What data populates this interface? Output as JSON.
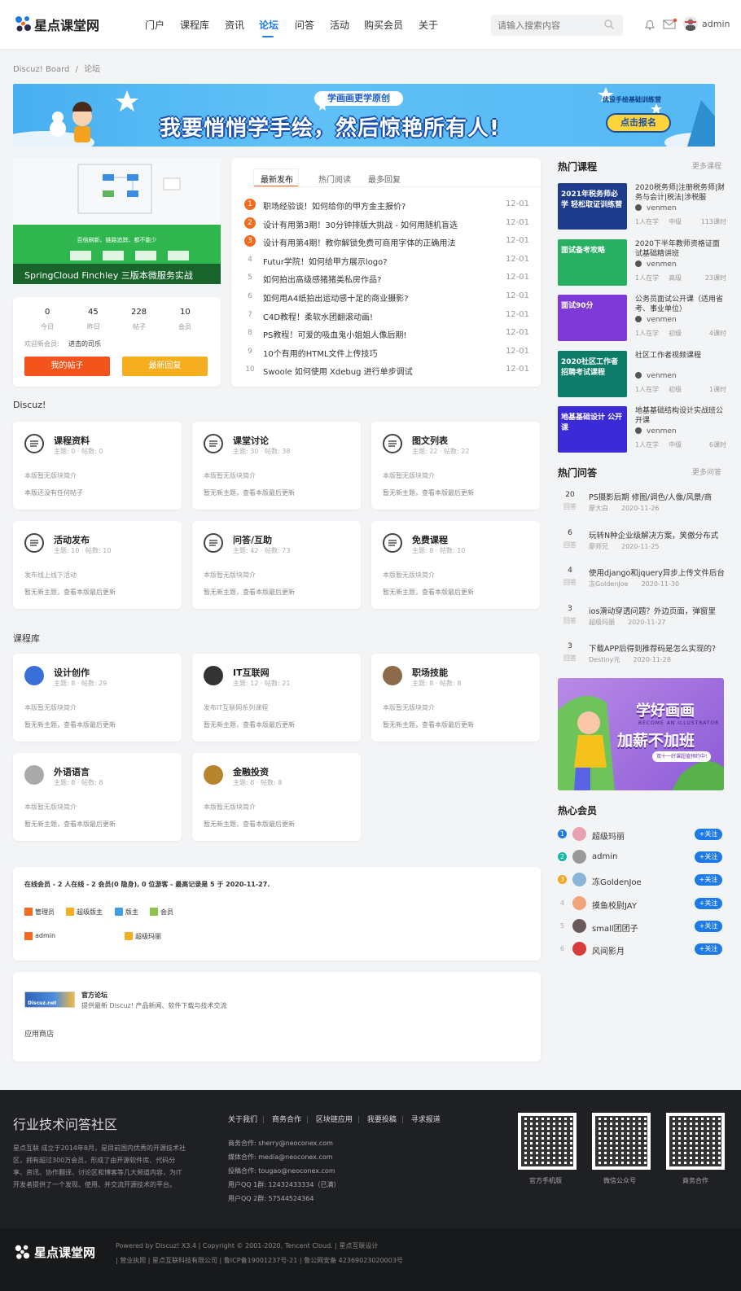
{
  "header": {
    "logo_text": "星点课堂网",
    "nav": [
      "门户",
      "课程库",
      "资讯",
      "论坛",
      "问答",
      "活动",
      "购买会员",
      "关于"
    ],
    "active_nav": "论坛",
    "search_placeholder": "请输入搜索内容",
    "username": "admin"
  },
  "breadcrumb": {
    "root": "Discuz! Board",
    "sep": "/",
    "current": "论坛"
  },
  "banner": {
    "tag": "学画画更学原创",
    "headline": "我要悄悄学手绘，然后惊艳所有人!",
    "side_text": "优设手绘基础训练营",
    "cta": "点击报名"
  },
  "slide": {
    "caption": "SpringCloud Finchley 三版本微服务实战",
    "inner_text": "百倍刷新、链路追踪、都不能少"
  },
  "stats": [
    {
      "value": "0",
      "label": "今日"
    },
    {
      "value": "45",
      "label": "昨日"
    },
    {
      "value": "228",
      "label": "帖子"
    },
    {
      "value": "10",
      "label": "会员"
    }
  ],
  "welcome": {
    "label": "欢迎新会员:",
    "name": "进击的司乐"
  },
  "buttons": {
    "my_posts": "我的帖子",
    "latest_replies": "最新回复"
  },
  "thread_tabs": [
    "最新发布",
    "热门阅读",
    "最多回复"
  ],
  "threads": [
    {
      "n": "1",
      "title": "职场经验谈！如何给你的甲方金主报价?",
      "date": "12-01"
    },
    {
      "n": "2",
      "title": "设计有用第3期！30分钟排版大挑战 - 如何用随机盲选",
      "date": "12-01"
    },
    {
      "n": "3",
      "title": "设计有用第4期！教你解锁免费可商用字体的正确用法",
      "date": "12-01"
    },
    {
      "n": "4",
      "title": "Futur学院！如何给甲方展示logo?",
      "date": "12-01"
    },
    {
      "n": "5",
      "title": "如何拍出高级感猪猪类私房作品?",
      "date": "12-01"
    },
    {
      "n": "6",
      "title": "如何用A4纸拍出运动感十足的商业摄影?",
      "date": "12-01"
    },
    {
      "n": "7",
      "title": "C4D教程！柔软水团翻滚动画!",
      "date": "12-01"
    },
    {
      "n": "8",
      "title": "PS教程！可爱的吸血鬼小姐姐人像后期!",
      "date": "12-01"
    },
    {
      "n": "9",
      "title": "10个有用的HTML文件上传技巧",
      "date": "12-01"
    },
    {
      "n": "10",
      "title": "Swoole 如何使用 Xdebug 进行单步调试",
      "date": "12-01"
    }
  ],
  "section_discuz": "Discuz!",
  "forums_discuz": [
    {
      "name": "课程资料",
      "stat": "主题: 0 · 帖数: 0",
      "desc": "本版暂无版块简介",
      "last": "本版还没有任何帖子"
    },
    {
      "name": "课堂讨论",
      "stat": "主题: 30 · 帖数: 38",
      "desc": "本版暂无版块简介",
      "last": "暂无新主题，查看本版最后更新"
    },
    {
      "name": "图文列表",
      "stat": "主题: 22 · 帖数: 22",
      "desc": "本版暂无版块简介",
      "last": "暂无新主题，查看本版最后更新"
    },
    {
      "name": "活动发布",
      "stat": "主题: 10 · 帖数: 10",
      "desc": "发布线上线下活动",
      "last": "暂无新主题，查看本版最后更新"
    },
    {
      "name": "问答/互助",
      "stat": "主题: 42 · 帖数: 73",
      "desc": "本版暂无版块简介",
      "last": "暂无新主题，查看本版最后更新"
    },
    {
      "name": "免费课程",
      "stat": "主题: 8 · 帖数: 10",
      "desc": "本版暂无版块简介",
      "last": "暂无新主题，查看本版最后更新"
    }
  ],
  "section_courses": "课程库",
  "forums_courses": [
    {
      "name": "设计创作",
      "stat": "主题: 8 · 帖数: 29",
      "desc": "本版暂无版块简介",
      "last": "暂无新主题，查看本版最后更新"
    },
    {
      "name": "IT互联网",
      "stat": "主题: 12 · 帖数: 21",
      "desc": "发布IT互联网系列课程",
      "last": "暂无新主题，查看本版最后更新"
    },
    {
      "name": "职场技能",
      "stat": "主题: 8 · 帖数: 8",
      "desc": "本版暂无版块简介",
      "last": "暂无新主题，查看本版最后更新"
    },
    {
      "name": "外语语言",
      "stat": "主题: 8 · 帖数: 8",
      "desc": "本版暂无版块简介",
      "last": "暂无新主题，查看本版最后更新"
    },
    {
      "name": "金融投资",
      "stat": "主题: 8 · 帖数: 8",
      "desc": "本版暂无版块简介",
      "last": "暂无新主题，查看本版最后更新"
    }
  ],
  "online": {
    "summary": "在线会员 - 2 人在线 - 2 会员(0 隐身), 0 位游客 - 最高记录是 5 于 2020-11-27.",
    "legend": [
      "管理员",
      "超级版主",
      "版主",
      "会员"
    ],
    "users": [
      "admin",
      "超级玛丽"
    ]
  },
  "links": {
    "official_title": "官方论坛",
    "official_desc": "提供最新 Discuz! 产品新闻、软件下载与技术交流",
    "app_store": "应用商店",
    "official_logo_text": "Discuz.net"
  },
  "hot_courses": {
    "title": "热门课程",
    "more": "更多课程",
    "items": [
      {
        "title": "2020税务师|注册税务师|财务与会计|税法|涉税服",
        "author": "venmen",
        "meta": [
          "1人在学",
          "中级",
          "113课时"
        ],
        "thumb": "2021年税务师必学 轻松取证训练营",
        "color": "#1d3b8a"
      },
      {
        "title": "2020下半年教师资格证面试基础精讲班",
        "author": "venmen",
        "meta": [
          "1人在学",
          "高级",
          "23课时"
        ],
        "thumb": "面试备考攻略",
        "color": "#27b062"
      },
      {
        "title": "公务员面试公开课（适用省考、事业单位）",
        "author": "venmen",
        "meta": [
          "1人在学",
          "初级",
          "4课时"
        ],
        "thumb": "面试90分",
        "color": "#7d3ad8"
      },
      {
        "title": "社区工作者视频课程",
        "author": "venmen",
        "meta": [
          "1人在学",
          "初级",
          "1课时"
        ],
        "thumb": "2020社区工作者 招聘考试课程",
        "color": "#0d7c68"
      },
      {
        "title": "地基基础结构设计实战班公开课",
        "author": "venmen",
        "meta": [
          "1人在学",
          "中级",
          "6课时"
        ],
        "thumb": "地基基础设计 公开课",
        "color": "#3a2bd6"
      }
    ]
  },
  "hot_qa": {
    "title": "热门问答",
    "more": "更多问答",
    "answer_label": "回答",
    "items": [
      {
        "count": "20",
        "title": "PS摄影后期 修图/调色/人像/风景/商",
        "user": "廖大白",
        "date": "2020-11-26"
      },
      {
        "count": "6",
        "title": "玩转N种企业级解决方案，笑傲分布式",
        "user": "廖师兄",
        "date": "2020-11-25"
      },
      {
        "count": "4",
        "title": "使用django和jquery异步上传文件后台",
        "user": "冻GoldenJoe",
        "date": "2020-11-30"
      },
      {
        "count": "3",
        "title": "ios滑动穿透问题？外边页面，弹窗里",
        "user": "超级玛丽",
        "date": "2020-11-27"
      },
      {
        "count": "3",
        "title": "下载APP后得到推荐码是怎么实现的?",
        "user": "Destiny元",
        "date": "2020-11-28"
      }
    ]
  },
  "ad": {
    "headline": "学好画画 加薪不加班",
    "sub": "BECOME AN ILLUSTRATOR",
    "cta": "双十一好课超值预约中!"
  },
  "hot_members": {
    "title": "热心会员",
    "follow_label": "+关注",
    "items": [
      {
        "rank": "1",
        "name": "超级玛丽",
        "color": "#1e7be6"
      },
      {
        "rank": "2",
        "name": "admin",
        "color": "#17b4a8"
      },
      {
        "rank": "3",
        "name": "冻GoldenJoe",
        "color": "#f5a623"
      },
      {
        "rank": "4",
        "name": "摸鱼校尉JAY",
        "color": "#bbbbbb"
      },
      {
        "rank": "5",
        "name": "small团团子",
        "color": "#bbbbbb"
      },
      {
        "rank": "6",
        "name": "风间影月",
        "color": "#bbbbbb"
      }
    ]
  },
  "footer": {
    "title": "行业技术问答社区",
    "about": "星点互联 成立于2014年8月，是目前国内优秀的开源技术社区，拥有超过300万会员，形成了由开源软件库、代码分享、资讯、协作翻译、讨论区和博客等几大频道内容，为IT开发者提供了一个发现、使用、并交流开源技术的平台。",
    "links": [
      "关于我们",
      "商务合作",
      "区块链应用",
      "我要投稿",
      "寻求报道"
    ],
    "contacts": [
      "商务合作: sherry@neoconex.com",
      "媒体合作: media@neoconex.com",
      "投稿合作: tougao@neoconex.com",
      "用户QQ 1群: 12432433334（已满）",
      "用户QQ 2群: 57544524364"
    ],
    "qr_labels": [
      "官方手机版",
      "微信公众号",
      "商务合作"
    ],
    "copyright": "Powered by Discuz! X3.4  |  Copyright © 2001-2020, Tencent Cloud.  |  星点互联设计",
    "license": "|  营业执照  |  星点互联科技有限公司  |  鲁ICP备19001237号-21  |  鲁公网安备 42369023020003号",
    "logo_text": "星点课堂网"
  },
  "colors": {
    "accent": "#1e7be6",
    "orange": "#f26b1f",
    "yellow": "#f5a623",
    "footer_bg": "#1f2023"
  }
}
